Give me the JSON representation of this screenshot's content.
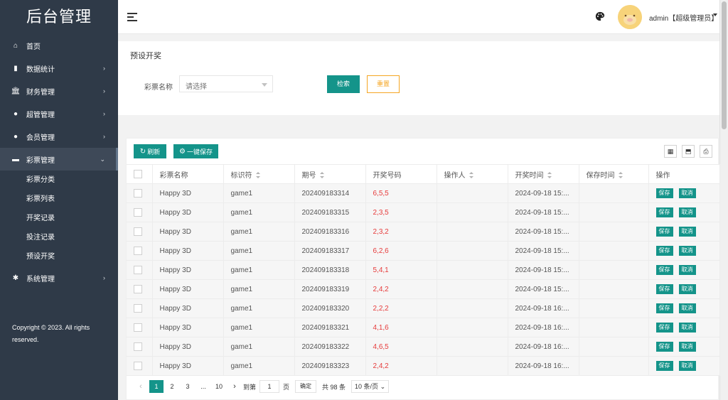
{
  "sidebar": {
    "logo": "后台管理",
    "items": [
      {
        "label": "首页",
        "icon": "home-icon",
        "glyph": "⌂",
        "has_arrow": false
      },
      {
        "label": "数据统计",
        "icon": "bar-chart-icon",
        "glyph": "▮",
        "has_arrow": true
      },
      {
        "label": "财务管理",
        "icon": "bank-icon",
        "glyph": "🏛",
        "has_arrow": true
      },
      {
        "label": "超管管理",
        "icon": "user-icon",
        "glyph": "●",
        "has_arrow": true
      },
      {
        "label": "会员管理",
        "icon": "users-icon",
        "glyph": "●",
        "has_arrow": true
      },
      {
        "label": "彩票管理",
        "icon": "gamepad-icon",
        "glyph": "▬",
        "has_arrow": true,
        "open": true
      }
    ],
    "subitems": [
      "彩票分类",
      "彩票列表",
      "开奖记录",
      "投注记录",
      "预设开奖"
    ],
    "system": {
      "label": "系统管理",
      "icon": "gear-icon",
      "glyph": "✱"
    },
    "copyright": "Copyright © 2023. All rights reserved."
  },
  "header": {
    "user": "admin【超级管理员】"
  },
  "search": {
    "panel_title": "预设开奖",
    "label": "彩票名称",
    "placeholder": "请选择",
    "search_button": "检索",
    "reset_button": "重置"
  },
  "toolbar": {
    "refresh": "刷新",
    "save_all": "一键保存"
  },
  "table": {
    "columns": [
      "彩票名称",
      "标识符",
      "期号",
      "开奖号码",
      "操作人",
      "开奖时间",
      "保存时间",
      "操作"
    ],
    "rows": [
      {
        "name": "Happy 3D",
        "code": "game1",
        "issue": "202409183314",
        "draw": "6,5,5",
        "operator": "",
        "draw_time": "2024-09-18 15:...",
        "save_time": ""
      },
      {
        "name": "Happy 3D",
        "code": "game1",
        "issue": "202409183315",
        "draw": "2,3,5",
        "operator": "",
        "draw_time": "2024-09-18 15:...",
        "save_time": ""
      },
      {
        "name": "Happy 3D",
        "code": "game1",
        "issue": "202409183316",
        "draw": "2,3,2",
        "operator": "",
        "draw_time": "2024-09-18 15:...",
        "save_time": ""
      },
      {
        "name": "Happy 3D",
        "code": "game1",
        "issue": "202409183317",
        "draw": "6,2,6",
        "operator": "",
        "draw_time": "2024-09-18 15:...",
        "save_time": ""
      },
      {
        "name": "Happy 3D",
        "code": "game1",
        "issue": "202409183318",
        "draw": "5,4,1",
        "operator": "",
        "draw_time": "2024-09-18 15:...",
        "save_time": ""
      },
      {
        "name": "Happy 3D",
        "code": "game1",
        "issue": "202409183319",
        "draw": "2,4,2",
        "operator": "",
        "draw_time": "2024-09-18 15:...",
        "save_time": ""
      },
      {
        "name": "Happy 3D",
        "code": "game1",
        "issue": "202409183320",
        "draw": "2,2,2",
        "operator": "",
        "draw_time": "2024-09-18 16:...",
        "save_time": ""
      },
      {
        "name": "Happy 3D",
        "code": "game1",
        "issue": "202409183321",
        "draw": "4,1,6",
        "operator": "",
        "draw_time": "2024-09-18 16:...",
        "save_time": ""
      },
      {
        "name": "Happy 3D",
        "code": "game1",
        "issue": "202409183322",
        "draw": "4,6,5",
        "operator": "",
        "draw_time": "2024-09-18 16:...",
        "save_time": ""
      },
      {
        "name": "Happy 3D",
        "code": "game1",
        "issue": "202409183323",
        "draw": "2,4,2",
        "operator": "",
        "draw_time": "2024-09-18 16:...",
        "save_time": ""
      }
    ],
    "save_label": "保存",
    "cancel_label": "取消"
  },
  "pager": {
    "pages": [
      "1",
      "2",
      "3",
      "...",
      "10"
    ],
    "goto_label": "到第",
    "current_input": "1",
    "page_unit": "页",
    "confirm": "确定",
    "total": "共 98 条",
    "page_size": "10 条/页"
  },
  "colors": {
    "sidebar_bg": "#2f3a48",
    "accent": "#14948a",
    "reset_border": "#f5a623",
    "draw_number": "#e63b3b"
  }
}
